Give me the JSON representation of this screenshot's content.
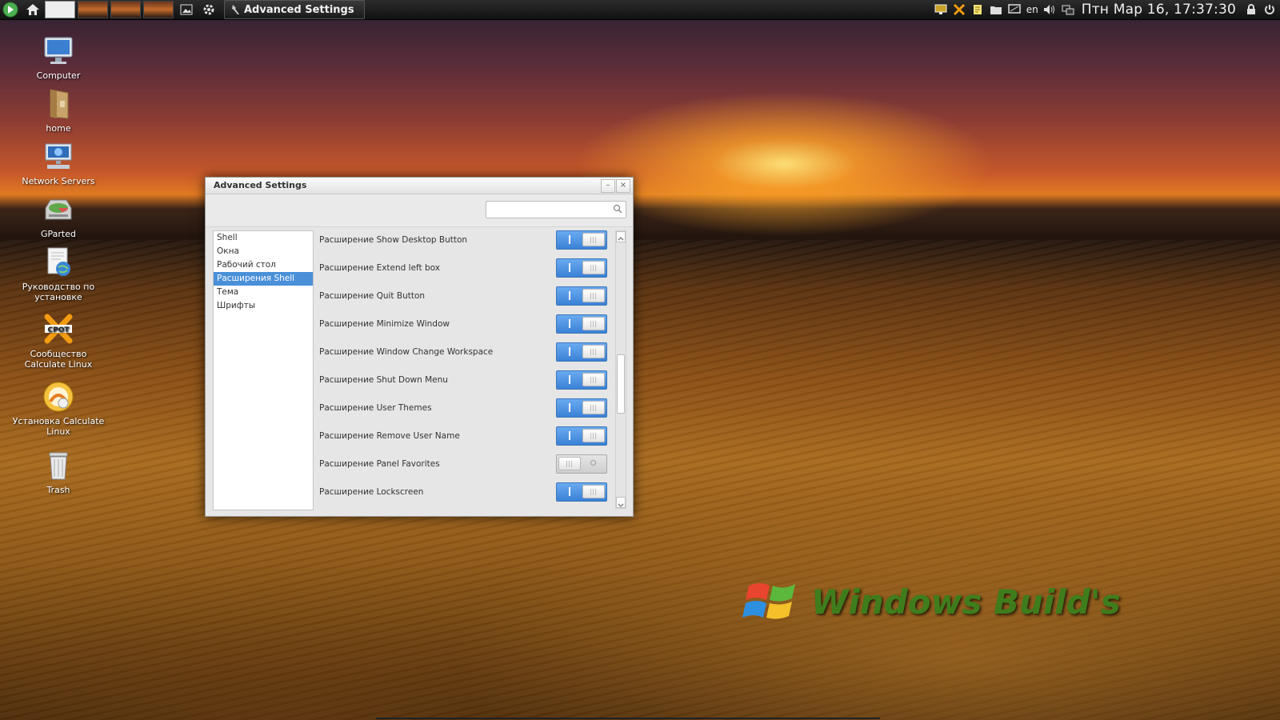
{
  "taskbar": {
    "active_task": "Advanced Settings",
    "language": "en",
    "clock": "Птн Мар 16, 17:37:30",
    "icons": [
      "start-icon",
      "home-icon",
      "window-thumbnail",
      "window-thumbnail",
      "window-thumbnail",
      "window-thumbnail",
      "image-viewer-icon",
      "gear-wrench-icon"
    ],
    "tray_icons": [
      "display-icon",
      "calculate-icon",
      "notes-icon",
      "folder-icon",
      "screen-icon",
      "volume-icon",
      "network-icon",
      "lock-icon",
      "power-icon"
    ]
  },
  "desktop": {
    "icons": [
      {
        "label": "Computer",
        "icon": "computer-icon"
      },
      {
        "label": "home",
        "icon": "home-folder-icon"
      },
      {
        "label": "Network Servers",
        "icon": "network-servers-icon"
      },
      {
        "label": "GParted",
        "icon": "gparted-icon"
      },
      {
        "label": "Руководство по установке",
        "icon": "install-guide-icon"
      },
      {
        "label": "Сообщество Calculate Linux",
        "icon": "community-icon"
      },
      {
        "label": "Установка Calculate Linux",
        "icon": "installer-icon"
      },
      {
        "label": "Trash",
        "icon": "trash-icon"
      }
    ]
  },
  "window": {
    "title": "Advanced Settings",
    "search": {
      "placeholder": "",
      "value": ""
    },
    "sidebar": [
      {
        "label": "Shell",
        "selected": false
      },
      {
        "label": "Окна",
        "selected": false
      },
      {
        "label": "Рабочий стол",
        "selected": false
      },
      {
        "label": "Расширения Shell",
        "selected": true
      },
      {
        "label": "Тема",
        "selected": false
      },
      {
        "label": "Шрифты",
        "selected": false
      }
    ],
    "extensions": [
      {
        "label": "Расширение Show Desktop Button",
        "enabled": true
      },
      {
        "label": "Расширение Extend left box",
        "enabled": true
      },
      {
        "label": "Расширение Quit Button",
        "enabled": true
      },
      {
        "label": "Расширение Minimize Window",
        "enabled": true
      },
      {
        "label": "Расширение Window Change Workspace",
        "enabled": true
      },
      {
        "label": "Расширение Shut Down Menu",
        "enabled": true
      },
      {
        "label": "Расширение User Themes",
        "enabled": true
      },
      {
        "label": "Расширение Remove User Name",
        "enabled": true
      },
      {
        "label": "Расширение Panel Favorites",
        "enabled": false
      },
      {
        "label": "Расширение Lockscreen",
        "enabled": true
      }
    ]
  },
  "watermark": {
    "text": "Windows Build's"
  },
  "colors": {
    "accent": "#4a90d9",
    "switch_on": "#3b82d6",
    "watermark": "#3f7d1c"
  }
}
